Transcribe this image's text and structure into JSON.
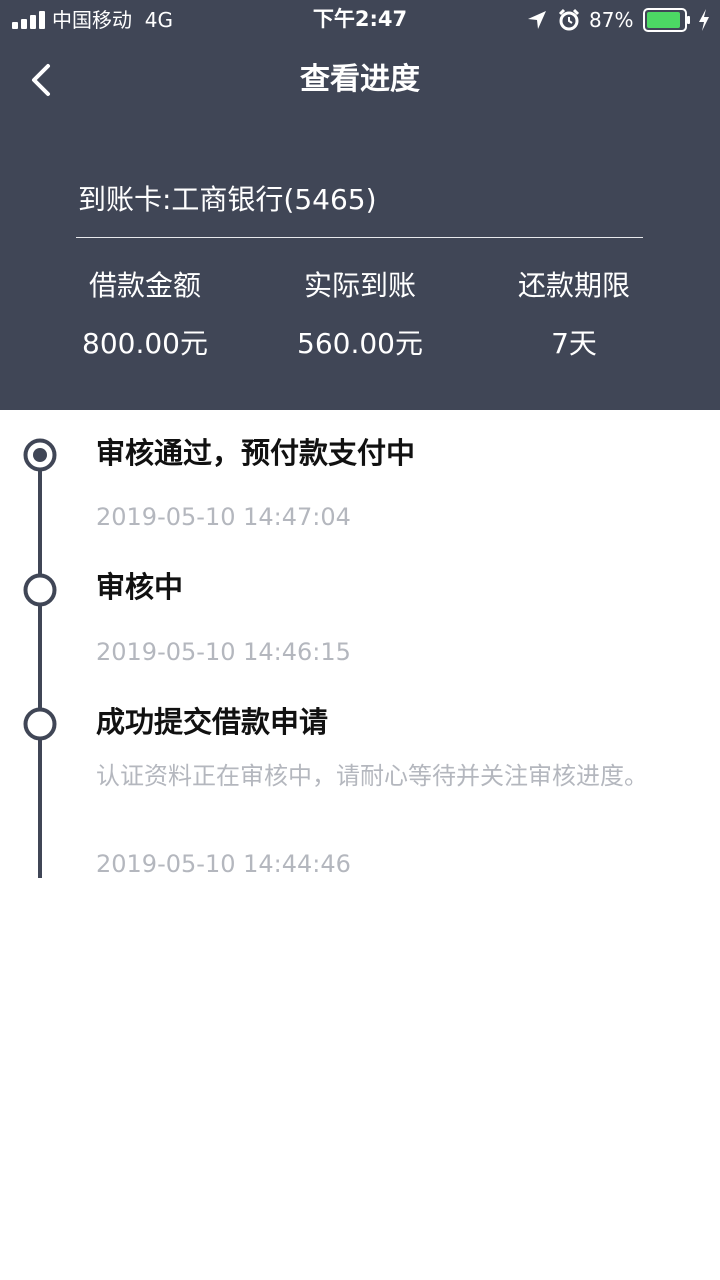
{
  "status_bar": {
    "carrier": "中国移动",
    "network": "4G",
    "time": "下午2:47",
    "battery_percent": "87%",
    "icons": [
      "signal-icon",
      "location-arrow-icon",
      "alarm-icon",
      "battery-icon",
      "charging-bolt-icon"
    ],
    "battery_color": "#4cd964"
  },
  "nav": {
    "back_icon": "chevron-left-icon",
    "title": "查看进度"
  },
  "loan": {
    "card_text": "到账卡:工商银行(5465)",
    "stats": [
      {
        "label": "借款金额",
        "value": "800.00元"
      },
      {
        "label": "实际到账",
        "value": "560.00元"
      },
      {
        "label": "还款期限",
        "value": "7天"
      }
    ]
  },
  "timeline": {
    "items": [
      {
        "title": "审核通过，预付款支付中",
        "time": "2019-05-10 14:47:04",
        "current": true
      },
      {
        "title": "审核中",
        "time": "2019-05-10 14:46:15",
        "current": false
      },
      {
        "title": "成功提交借款申请",
        "description": "认证资料正在审核中，请耐心等待并关注审核进度。",
        "time": "2019-05-10 14:44:46",
        "current": false
      }
    ]
  },
  "colors": {
    "header_bg": "#404656",
    "header_text": "#ffffff",
    "timeline_accent": "#404656",
    "muted_text": "#b4b7be",
    "title_text": "#111111"
  }
}
